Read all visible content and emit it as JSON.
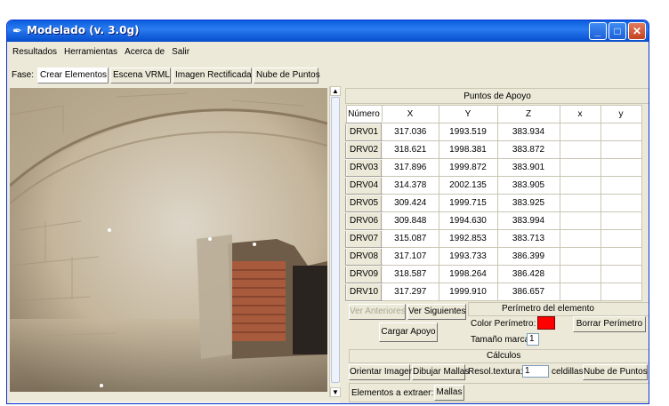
{
  "window": {
    "title": "Modelado (v. 3.0g)",
    "controls": [
      "_",
      "□",
      "✕"
    ]
  },
  "menu": [
    "Resultados",
    "Herramientas",
    "Acerca de",
    "Salir"
  ],
  "fase": {
    "label": "Fase:",
    "tabs": [
      "Crear Elementos",
      "Escena VRML",
      "Imagen Rectificada",
      "Nube de Puntos"
    ],
    "active": 0
  },
  "table": {
    "title": "Puntos de Apoyo",
    "headers": [
      "Número",
      "X",
      "Y",
      "Z",
      "x",
      "y"
    ],
    "rows": [
      [
        "DRV01",
        "317.036",
        "1993.519",
        "383.934"
      ],
      [
        "DRV02",
        "318.621",
        "1998.381",
        "383.872"
      ],
      [
        "DRV03",
        "317.896",
        "1999.872",
        "383.901"
      ],
      [
        "DRV04",
        "314.378",
        "2002.135",
        "383.905"
      ],
      [
        "DRV05",
        "309.424",
        "1999.715",
        "383.925"
      ],
      [
        "DRV06",
        "309.848",
        "1994.630",
        "383.994"
      ],
      [
        "DRV07",
        "315.087",
        "1992.853",
        "383.713"
      ],
      [
        "DRV08",
        "317.107",
        "1993.733",
        "386.399"
      ],
      [
        "DRV09",
        "318.587",
        "1998.264",
        "386.428"
      ],
      [
        "DRV10",
        "317.297",
        "1999.910",
        "386.657"
      ]
    ]
  },
  "controls": {
    "prev": "Ver Anteriores",
    "next": "Ver Siguientes",
    "load": "Cargar Apoyo",
    "perimeter_title": "Perímetro del elemento",
    "color_label": "Color Perímetro:",
    "perimeter_color": "#ff0000",
    "delete_perimeter": "Borrar Perímetro",
    "mark_size_label": "Tamaño marca:",
    "mark_size_value": "1"
  },
  "calculos": {
    "title": "Cálculos",
    "orient": "Orientar Imagen",
    "draw_mesh": "Dibujar Mallas",
    "texture_label": "Resol.textura:",
    "texture_value": "1",
    "cells_label": "celdillas",
    "point_cloud": "Nube de Puntos"
  },
  "extract": {
    "label": "Elementos a extraer:",
    "button": "Mallas"
  },
  "icons": [
    "app-feather-icon",
    "scroll-up-arrow-icon",
    "scroll-down-arrow-icon"
  ]
}
